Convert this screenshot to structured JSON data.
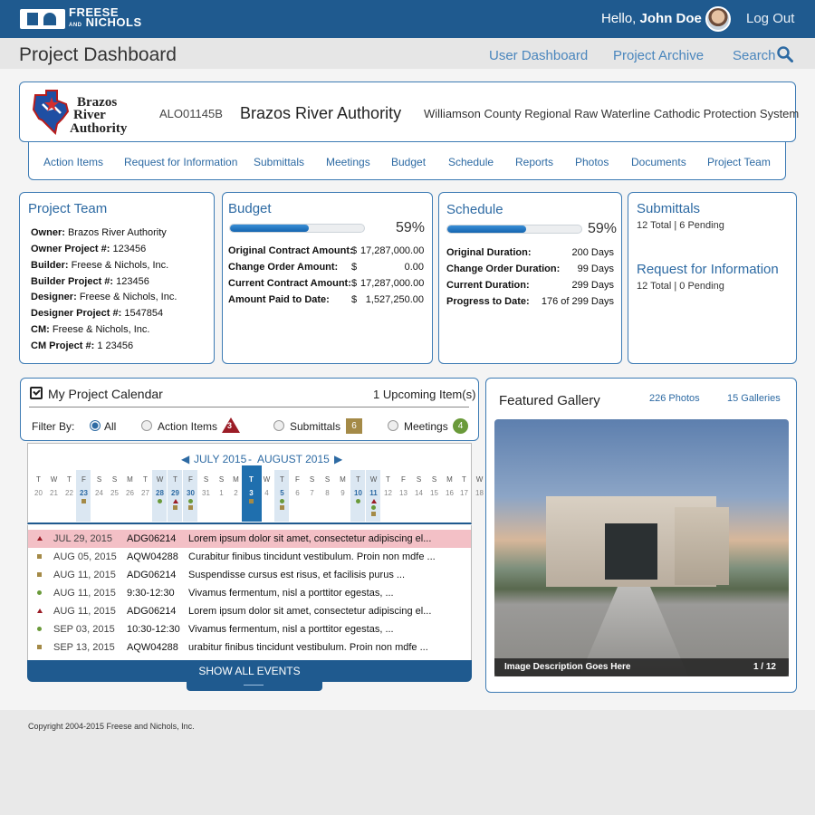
{
  "header": {
    "logo_text_top": "FREESE",
    "logo_text_and": "AND",
    "logo_text_bottom": "NICHOLS",
    "greeting": "Hello,",
    "user_name": "John Doe",
    "logout_label": "Log Out"
  },
  "titlebar": {
    "title": "Project Dashboard",
    "links": [
      "User Dashboard",
      "Project Archive",
      "Search"
    ]
  },
  "project": {
    "logo_lines": [
      "Brazos",
      "River",
      "Authority"
    ],
    "code": "ALO01145B",
    "name": "Brazos River Authority",
    "description": "Williamson County Regional Raw Waterline Cathodic Protection System"
  },
  "tabs": [
    "Action Items",
    "Request for Information",
    "Submittals",
    "Meetings",
    "Budget",
    "Schedule",
    "Reports",
    "Photos",
    "Documents",
    "Project Team"
  ],
  "team": {
    "title": "Project Team",
    "rows": [
      {
        "label": "Owner:",
        "value": "Brazos River Authority"
      },
      {
        "label": "Owner Project #:",
        "value": "123456"
      },
      {
        "label": "Builder:",
        "value": "Freese & Nichols, Inc."
      },
      {
        "label": "Builder Project #:",
        "value": "123456"
      },
      {
        "label": "Designer:",
        "value": "Freese & Nichols, Inc."
      },
      {
        "label": "Designer Project #:",
        "value": "1547854"
      },
      {
        "label": "CM:",
        "value": "Freese & Nichols, Inc."
      },
      {
        "label": "CM Project #:",
        "value": "1 23456"
      }
    ]
  },
  "budget": {
    "title": "Budget",
    "percent_label": "59%",
    "progress": 0.59,
    "rows": [
      {
        "label": "Original Contract Amount:",
        "currency": "$",
        "value": "17,287,000.00"
      },
      {
        "label": "Change Order Amount:",
        "currency": "$",
        "value": "0.00"
      },
      {
        "label": "Current Contract Amount:",
        "currency": "$",
        "value": "17,287,000.00"
      },
      {
        "label": "Amount Paid to Date:",
        "currency": "$",
        "value": "1,527,250.00"
      }
    ]
  },
  "schedule": {
    "title": "Schedule",
    "percent_label": "59%",
    "progress": 0.59,
    "rows": [
      {
        "label": "Original Duration:",
        "value": "200 Days"
      },
      {
        "label": "Change Order Duration:",
        "value": "99  Days"
      },
      {
        "label": "Current Duration:",
        "value": "299  Days"
      },
      {
        "label": "Progress to Date:",
        "value": "176 of 299  Days"
      }
    ]
  },
  "submittals": {
    "title": "Submittals",
    "summary": "12 Total  |  6 Pending"
  },
  "rfi": {
    "title": "Request for Information",
    "summary": "12 Total  |  0 Pending"
  },
  "calendar": {
    "title": "My Project Calendar",
    "upcoming": "1 Upcoming Item(s)",
    "filter_label": "Filter By:",
    "filters": [
      {
        "label": "All",
        "selected": true
      },
      {
        "label": "Action Items",
        "count": "3"
      },
      {
        "label": "Submittals",
        "count": "6"
      },
      {
        "label": "Meetings",
        "count": "4"
      }
    ],
    "month_a": "JULY 2015",
    "month_sep": "-",
    "month_b": "AUGUST 2015",
    "prev_icon": "triangle-left-icon",
    "next_icon": "triangle-right-icon",
    "days": [
      {
        "d": "T",
        "n": "20"
      },
      {
        "d": "W",
        "n": "21"
      },
      {
        "d": "T",
        "n": "22"
      },
      {
        "d": "F",
        "n": "23"
      },
      {
        "d": "S",
        "n": "24"
      },
      {
        "d": "S",
        "n": "25"
      },
      {
        "d": "M",
        "n": "26"
      },
      {
        "d": "T",
        "n": "27"
      },
      {
        "d": "W",
        "n": "28"
      },
      {
        "d": "T",
        "n": "29"
      },
      {
        "d": "F",
        "n": "30"
      },
      {
        "d": "S",
        "n": "31"
      },
      {
        "d": "S",
        "n": "1"
      },
      {
        "d": "M",
        "n": "2"
      },
      {
        "d": "T",
        "n": "3"
      },
      {
        "d": "W",
        "n": "4"
      },
      {
        "d": "T",
        "n": "5"
      },
      {
        "d": "F",
        "n": "6"
      },
      {
        "d": "S",
        "n": "7"
      },
      {
        "d": "S",
        "n": "8"
      },
      {
        "d": "M",
        "n": "9"
      },
      {
        "d": "T",
        "n": "10"
      },
      {
        "d": "W",
        "n": "11"
      },
      {
        "d": "T",
        "n": "12"
      },
      {
        "d": "F",
        "n": "13"
      },
      {
        "d": "S",
        "n": "14"
      },
      {
        "d": "S",
        "n": "15"
      },
      {
        "d": "M",
        "n": "16"
      },
      {
        "d": "T",
        "n": "17"
      },
      {
        "d": "W",
        "n": "18"
      }
    ],
    "events": [
      {
        "type": "action",
        "date": "JUL 29, 2015",
        "code": "ADG06214",
        "text": "Lorem ipsum dolor sit amet, consectetur adipiscing el...",
        "highlight": true
      },
      {
        "type": "submittal",
        "date": "AUG 05, 2015",
        "code": "AQW04288",
        "text": "Curabitur finibus tincidunt vestibulum. Proin non mdfe ..."
      },
      {
        "type": "submittal",
        "date": "AUG 11, 2015",
        "code": "ADG06214",
        "text": "Suspendisse cursus est risus, et facilisis purus  ..."
      },
      {
        "type": "meeting",
        "date": "AUG 11, 2015",
        "code": "9:30-12:30",
        "text": "Vivamus fermentum, nisl a porttitor egestas, ..."
      },
      {
        "type": "action",
        "date": "AUG 11, 2015",
        "code": "ADG06214",
        "text": "Lorem ipsum dolor sit amet, consectetur adipiscing el..."
      },
      {
        "type": "meeting",
        "date": "SEP 03, 2015",
        "code": "10:30-12:30",
        "text": "Vivamus fermentum, nisl a porttitor egestas, ..."
      },
      {
        "type": "submittal",
        "date": "SEP 13, 2015",
        "code": "AQW04288",
        "text": "urabitur finibus tincidunt vestibulum. Proin non mdfe ..."
      }
    ],
    "show_all": "SHOW ALL EVENTS"
  },
  "gallery": {
    "title": "Featured Gallery",
    "photos_link": "226 Photos",
    "galleries_link": "15 Galleries",
    "caption": "Image Description Goes Here",
    "counter": "1 / 12"
  },
  "footer": {
    "copyright": "Copyright 2004-2015 Freese and Nichols, Inc."
  },
  "colors": {
    "brand_blue": "#1f5a8f",
    "link_blue": "#2d6aa3",
    "action_red": "#9b1c26",
    "submittal_gold": "#a48a47",
    "meeting_green": "#6a9a3a",
    "highlight_row": "#f3c0c6"
  }
}
